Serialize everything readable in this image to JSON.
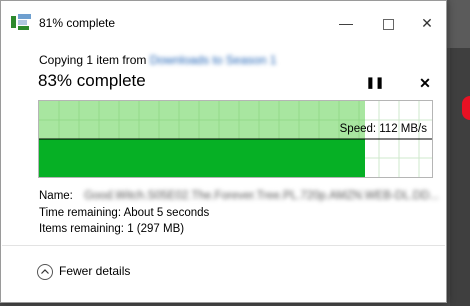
{
  "window": {
    "title": "81% complete",
    "minimize_glyph": "—",
    "close_glyph": "✕"
  },
  "dialog": {
    "copy_prefix": "Copying 1 item from",
    "copy_source": "Downloads",
    "copy_to": "to",
    "copy_dest": "Season 1",
    "percent_text": "83% complete",
    "pause_glyph": "❚❚",
    "cancel_glyph": "✕"
  },
  "graph": {
    "progress_fraction": 0.83,
    "speed_label": "Speed: 112 MB/s",
    "accent_light": "#a8e6a0",
    "accent_dark": "#06b025"
  },
  "details": {
    "name_label": "Name:",
    "name_value": "Good.Witch.S05E02.The.Forever.Tree.PL.720p.AMZN.WEB-DL.DD...",
    "time_label": "Time remaining:",
    "time_value": "About 5 seconds",
    "items_label": "Items remaining:",
    "items_value": "1 (297 MB)"
  },
  "footer": {
    "toggle_label": "Fewer details",
    "icon": "chevron-up-icon"
  }
}
